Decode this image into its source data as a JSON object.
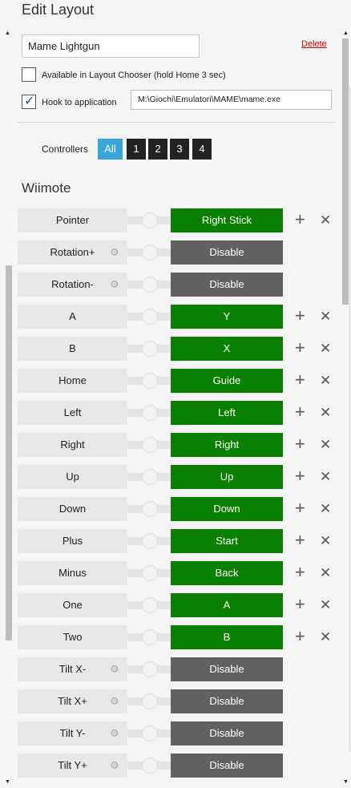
{
  "header": {
    "title": "Edit Layout"
  },
  "layout": {
    "name": "Mame Lightgun",
    "delete_label": "Delete",
    "available_label": "Available in Layout Chooser (hold Home 3 sec)",
    "available_checked": false,
    "hook_label": "Hook to application",
    "hook_checked": true,
    "hook_path": "M:\\Giochi\\Emulatori\\MAME\\mame.exe"
  },
  "controllers": {
    "label": "Controllers",
    "options": [
      "All",
      "1",
      "2",
      "3",
      "4"
    ],
    "selected": "All"
  },
  "section": {
    "title": "Wiimote"
  },
  "colors": {
    "accent": "#3aa6d8",
    "mapped": "#0a8000",
    "disabled": "#616161",
    "delete": "#d20000"
  },
  "mappings": [
    {
      "source": "Pointer",
      "target": "Right Stick",
      "state": "mapped",
      "gear": false
    },
    {
      "source": "Rotation+",
      "target": "Disable",
      "state": "disabled",
      "gear": true
    },
    {
      "source": "Rotation-",
      "target": "Disable",
      "state": "disabled",
      "gear": true
    },
    {
      "source": "A",
      "target": "Y",
      "state": "mapped",
      "gear": false
    },
    {
      "source": "B",
      "target": "X",
      "state": "mapped",
      "gear": false
    },
    {
      "source": "Home",
      "target": "Guide",
      "state": "mapped",
      "gear": false
    },
    {
      "source": "Left",
      "target": "Left",
      "state": "mapped",
      "gear": false
    },
    {
      "source": "Right",
      "target": "Right",
      "state": "mapped",
      "gear": false
    },
    {
      "source": "Up",
      "target": "Up",
      "state": "mapped",
      "gear": false
    },
    {
      "source": "Down",
      "target": "Down",
      "state": "mapped",
      "gear": false
    },
    {
      "source": "Plus",
      "target": "Start",
      "state": "mapped",
      "gear": false
    },
    {
      "source": "Minus",
      "target": "Back",
      "state": "mapped",
      "gear": false
    },
    {
      "source": "One",
      "target": "A",
      "state": "mapped",
      "gear": false
    },
    {
      "source": "Two",
      "target": "B",
      "state": "mapped",
      "gear": false
    },
    {
      "source": "Tilt X-",
      "target": "Disable",
      "state": "disabled",
      "gear": true
    },
    {
      "source": "Tilt X+",
      "target": "Disable",
      "state": "disabled",
      "gear": true
    },
    {
      "source": "Tilt Y-",
      "target": "Disable",
      "state": "disabled",
      "gear": true
    },
    {
      "source": "Tilt Y+",
      "target": "Disable",
      "state": "disabled",
      "gear": true
    }
  ],
  "icons": {
    "add": "plus-icon",
    "remove": "close-icon",
    "settings": "gear-icon",
    "check": "checkmark-icon"
  }
}
